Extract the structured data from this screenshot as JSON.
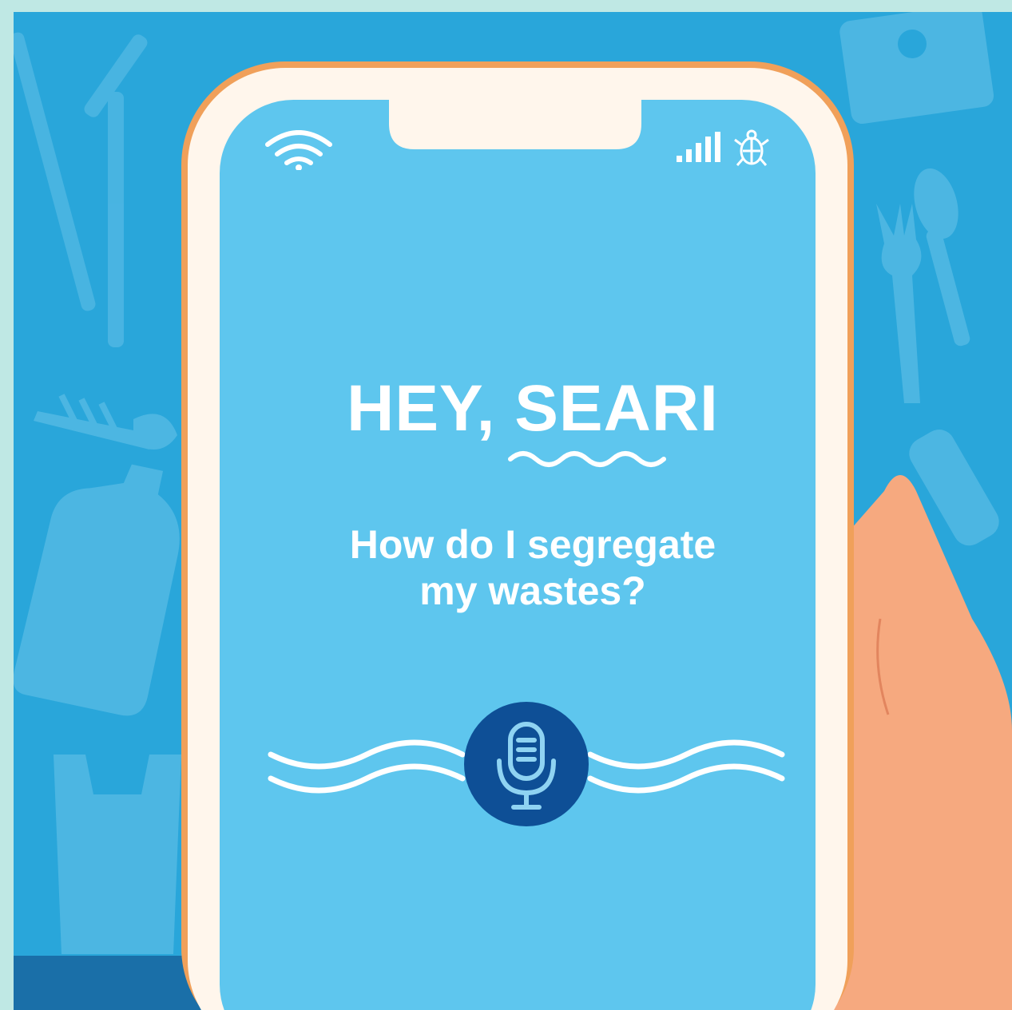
{
  "screen": {
    "headline_prefix": "HEY, ",
    "headline_name": "SEARI",
    "question_line1": "How do I segregate",
    "question_line2": "my wastes?"
  },
  "status_bar": {
    "wifi_icon": "wifi-icon",
    "signal_icon": "signal-bars-icon",
    "turtle_icon": "turtle-icon"
  },
  "voice": {
    "mic_icon": "microphone-icon"
  },
  "colors": {
    "background_blue": "#29a6da",
    "screen_blue": "#5ec6ee",
    "phone_bezel": "#fff6ec",
    "phone_edge": "#f0a05a",
    "mic_button": "#0e4f96",
    "hand": "#f6a97f",
    "frame": "#bfe8e4"
  }
}
